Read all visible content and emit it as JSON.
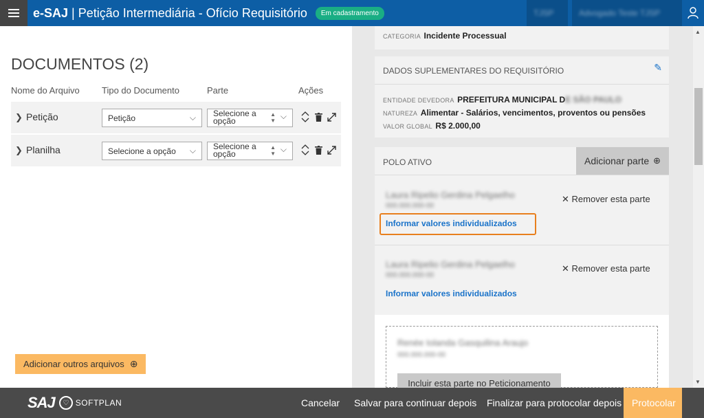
{
  "header": {
    "brand": "e-SAJ",
    "title": "Petição Intermediária - Ofício Requisitório",
    "status_badge": "Em cadastramento",
    "blurred_left": "TJSP",
    "blurred_right": "Advogado Teste TJSP"
  },
  "documents": {
    "title": "DOCUMENTOS (2)",
    "columns": [
      "Nome do Arquivo",
      "Tipo do Documento",
      "Parte",
      "Ações"
    ],
    "rows": [
      {
        "name": "Petição",
        "type": "Petição",
        "party": "Selecione a opção"
      },
      {
        "name": "Planilha",
        "type": "Selecione a opção",
        "party": "Selecione a opção"
      }
    ],
    "add_files_label": "Adicionar outros arquivos"
  },
  "category": {
    "label": "CATEGORIA",
    "value": "Incidente Processual"
  },
  "supplementary": {
    "title": "DADOS SUPLEMENTARES DO REQUISITÓRIO",
    "debtor_label": "ENTIDADE DEVEDORA",
    "debtor_value": "PREFEITURA MUNICIPAL D",
    "debtor_blur": "E SÃO PAULO",
    "nature_label": "NATUREZA",
    "nature_value": "Alimentar - Salários, vencimentos, proventos ou pensões",
    "global_label": "VALOR GLOBAL",
    "global_value": "R$ 2.000,00"
  },
  "polo_ativo": {
    "title": "POLO ATIVO",
    "add_party_label": "Adicionar parte",
    "parties": [
      {
        "name_blur": "Laura Ripelio Gerdina Pelgaelho",
        "doc_blur": "000.000.000-00",
        "remove_label": "Remover esta parte",
        "link_label": "Informar valores individualizados"
      },
      {
        "name_blur": "Laura Ripelio Gerdina Pelgaelho",
        "doc_blur": "000.000.000-00",
        "remove_label": "Remover esta parte",
        "link_label": "Informar valores individualizados"
      }
    ]
  },
  "pending_party": {
    "name_blur": "Renée Iolanda Gasquilina Araujo",
    "doc_blur": "000.000.000-00",
    "include_label": "Incluir esta parte no Peticionamento"
  },
  "footer": {
    "logo_text": "SAJ",
    "logo_brand": "SOFTPLAN",
    "cancel": "Cancelar",
    "save_later": "Salvar para continuar depois",
    "finalize": "Finalizar para protocolar depois",
    "submit": "Protocolar"
  },
  "colors": {
    "topbar": "#0d5ea5",
    "accent_orange": "#fbb962",
    "link_blue": "#1a73c9",
    "badge_green": "#1aae84",
    "highlight_orange": "#e87f1d"
  }
}
